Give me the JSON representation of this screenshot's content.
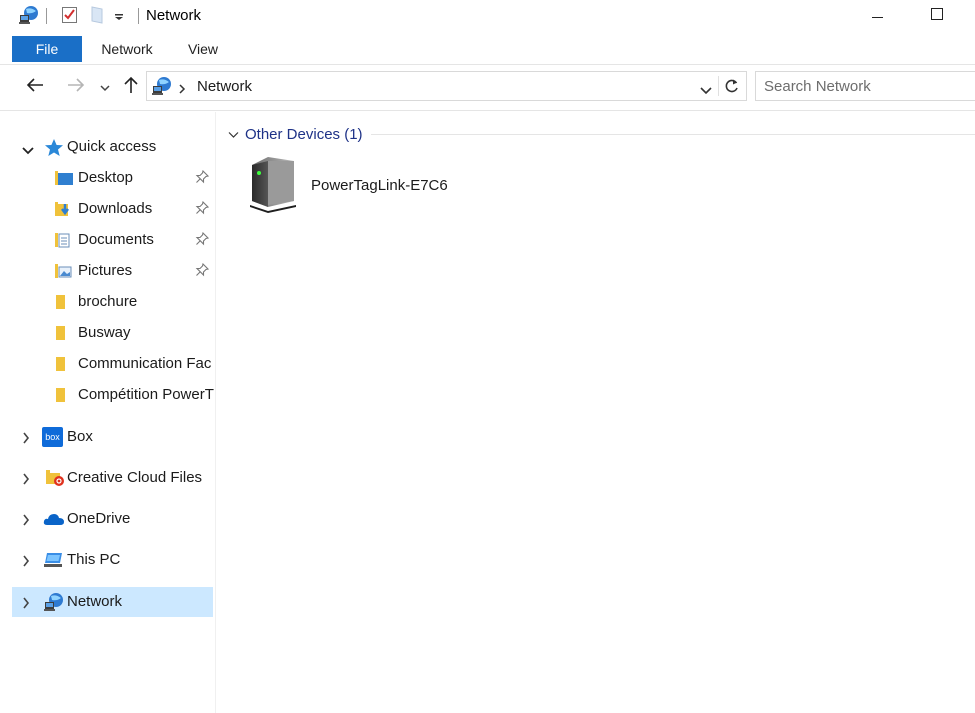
{
  "window": {
    "title": "Network",
    "minimize_icon": "minimize-icon",
    "maximize_icon": "maximize-icon"
  },
  "ribbon": {
    "tabs": [
      {
        "label": "File",
        "active": true,
        "color": "#1a6fc7"
      },
      {
        "label": "Network"
      },
      {
        "label": "View"
      }
    ]
  },
  "address_bar": {
    "path": [
      "Network"
    ],
    "location_icon": "network-icon"
  },
  "search": {
    "placeholder": "Search Network"
  },
  "nav_pane": {
    "quick_access": {
      "label": "Quick access",
      "items": [
        {
          "label": "Desktop",
          "pinned": true
        },
        {
          "label": "Downloads",
          "pinned": true
        },
        {
          "label": "Documents",
          "pinned": true
        },
        {
          "label": "Pictures",
          "pinned": true
        },
        {
          "label": "brochure"
        },
        {
          "label": "Busway"
        },
        {
          "label": "Communication Fac"
        },
        {
          "label": "Compétition PowerT"
        }
      ]
    },
    "roots": [
      {
        "label": "Box",
        "icon": "box-icon"
      },
      {
        "label": "Creative Cloud Files",
        "icon": "creative-cloud-icon"
      },
      {
        "label": "OneDrive",
        "icon": "onedrive-icon"
      },
      {
        "label": "This PC",
        "icon": "this-pc-icon"
      },
      {
        "label": "Network",
        "icon": "network-icon",
        "selected": true
      }
    ],
    "selection_color": "#cce8ff"
  },
  "content": {
    "group_label": "Other Devices (1)",
    "group_color": "#1e3287",
    "devices": [
      {
        "label": "PowerTagLink-E7C6",
        "icon": "network-device-icon"
      }
    ]
  }
}
